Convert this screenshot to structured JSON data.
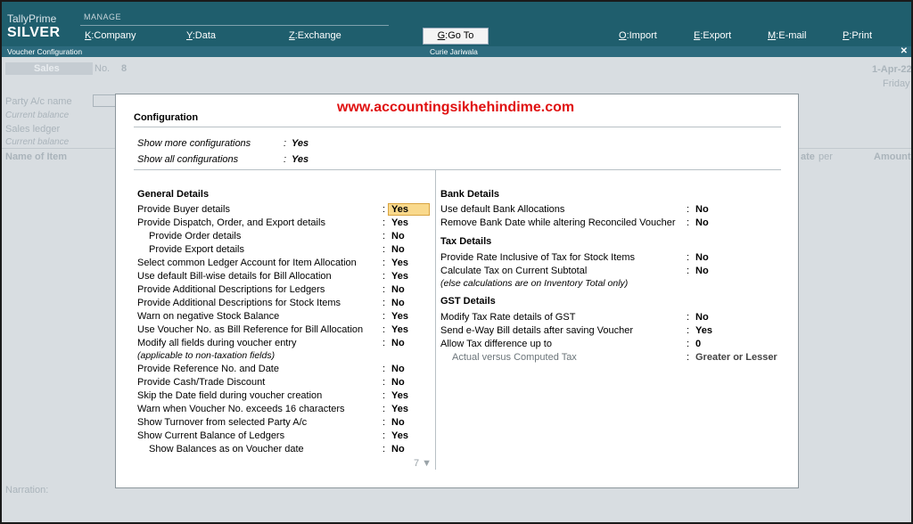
{
  "topbar": {
    "brand_top": "TallyPrime",
    "brand_main": "SILVER",
    "manage_label": "MANAGE",
    "menus": [
      {
        "key": "K",
        "label": ":Company"
      },
      {
        "key": "Y",
        "label": ":Data"
      },
      {
        "key": "Z",
        "label": ":Exchange"
      },
      {
        "key": "G",
        "label": ":Go To"
      },
      {
        "key": "O",
        "label": ":Import"
      },
      {
        "key": "E",
        "label": ":Export"
      },
      {
        "key": "M",
        "label": ":E-mail"
      },
      {
        "key": "P",
        "label": ":Print"
      }
    ]
  },
  "titlestrip": {
    "left": "Voucher Configuration",
    "center": "Curie Jariwala",
    "close": "✕"
  },
  "background_voucher": {
    "voucher_type": "Sales",
    "no_label": "No.",
    "no_value": "8",
    "date": "1-Apr-22",
    "day": "Friday",
    "party_label": "Party A/c name",
    "current_balance_1": "Current balance",
    "sales_ledger": "Sales ledger",
    "current_balance_2": "Current balance",
    "name_of_item": "Name of Item",
    "rate": "ate",
    "per": "per",
    "amount": "Amount",
    "narration": "Narration:"
  },
  "modal": {
    "watermark": "www.accountingsikhehindime.com",
    "title": "Configuration",
    "top_options": [
      {
        "label": "Show more configurations",
        "value": "Yes"
      },
      {
        "label": "Show all configurations",
        "value": "Yes"
      }
    ],
    "general": {
      "heading": "General Details",
      "rows": [
        {
          "label": "Provide Buyer details",
          "value": "Yes"
        },
        {
          "label": "Provide Dispatch, Order, and Export details",
          "value": "Yes"
        },
        {
          "label": "Provide Order details",
          "value": "No"
        },
        {
          "label": "Provide Export details",
          "value": "No"
        },
        {
          "label": "Select common Ledger Account for Item Allocation",
          "value": "Yes"
        },
        {
          "label": "Use default Bill-wise details for Bill Allocation",
          "value": "Yes"
        },
        {
          "label": "Provide Additional Descriptions for Ledgers",
          "value": "No"
        },
        {
          "label": "Provide Additional Descriptions for Stock Items",
          "value": "No"
        },
        {
          "label": "Warn on negative Stock Balance",
          "value": "Yes"
        },
        {
          "label": "Use Voucher No. as Bill Reference for Bill Allocation",
          "value": "Yes"
        },
        {
          "label": "Modify all fields during voucher entry",
          "value": "No"
        },
        {
          "label": "Provide Reference No. and Date",
          "value": "No"
        },
        {
          "label": "Provide Cash/Trade Discount",
          "value": "No"
        },
        {
          "label": "Skip the Date field during voucher creation",
          "value": "Yes"
        },
        {
          "label": "Warn when Voucher No. exceeds 16 characters",
          "value": "Yes"
        },
        {
          "label": "Show Turnover from selected Party A/c",
          "value": "No"
        },
        {
          "label": "Show Current Balance of Ledgers",
          "value": "Yes"
        },
        {
          "label": "Show Balances as on Voucher date",
          "value": "No"
        }
      ],
      "note": "(applicable to non-taxation fields)"
    },
    "bank": {
      "heading": "Bank Details",
      "rows": [
        {
          "label": "Use default Bank Allocations",
          "value": "No"
        },
        {
          "label": "Remove Bank Date while altering Reconciled Voucher",
          "value": "No"
        }
      ]
    },
    "tax": {
      "heading": "Tax Details",
      "rows": [
        {
          "label": "Provide Rate Inclusive of Tax for Stock Items",
          "value": "No"
        },
        {
          "label": "Calculate Tax on Current Subtotal",
          "value": "No"
        }
      ],
      "note": "(else calculations are on Inventory Total only)"
    },
    "gst": {
      "heading": "GST Details",
      "rows": [
        {
          "label": "Modify Tax Rate details of GST",
          "value": "No"
        },
        {
          "label": "Send e-Way Bill details after saving Voucher",
          "value": "Yes"
        },
        {
          "label": "Allow Tax difference up to",
          "value": "0"
        },
        {
          "label": "Actual versus Computed Tax",
          "value": "Greater or Lesser"
        }
      ]
    },
    "page_indicator": "7 ▼"
  }
}
